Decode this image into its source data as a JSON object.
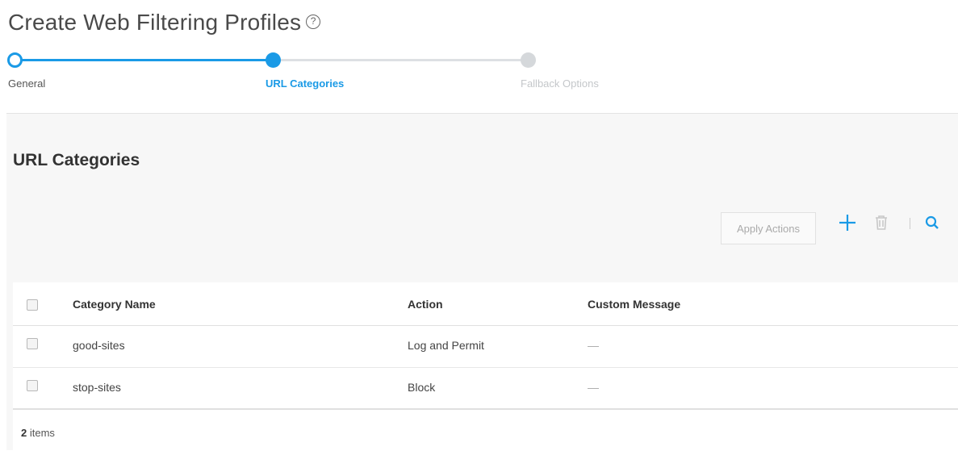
{
  "page": {
    "title": "Create Web Filtering Profiles",
    "help_icon": "?"
  },
  "wizard": {
    "steps": [
      {
        "label": "General",
        "state": "completed"
      },
      {
        "label": "URL Categories",
        "state": "active"
      },
      {
        "label": "Fallback Options",
        "state": "pending"
      }
    ]
  },
  "section": {
    "title": "URL Categories"
  },
  "toolbar": {
    "apply_actions_label": "Apply Actions",
    "icons": [
      "plus-icon",
      "trash-icon",
      "search-icon"
    ]
  },
  "table": {
    "columns": [
      "Category Name",
      "Action",
      "Custom Message"
    ],
    "rows": [
      {
        "category_name": "good-sites",
        "action": "Log and Permit",
        "custom_message": "—"
      },
      {
        "category_name": "stop-sites",
        "action": "Block",
        "custom_message": "—"
      }
    ]
  },
  "footer": {
    "count": "2",
    "unit": "items"
  },
  "colors": {
    "accent": "#1a9ae6",
    "panel_bg": "#f7f7f7",
    "pending_step": "#d5d8db"
  }
}
